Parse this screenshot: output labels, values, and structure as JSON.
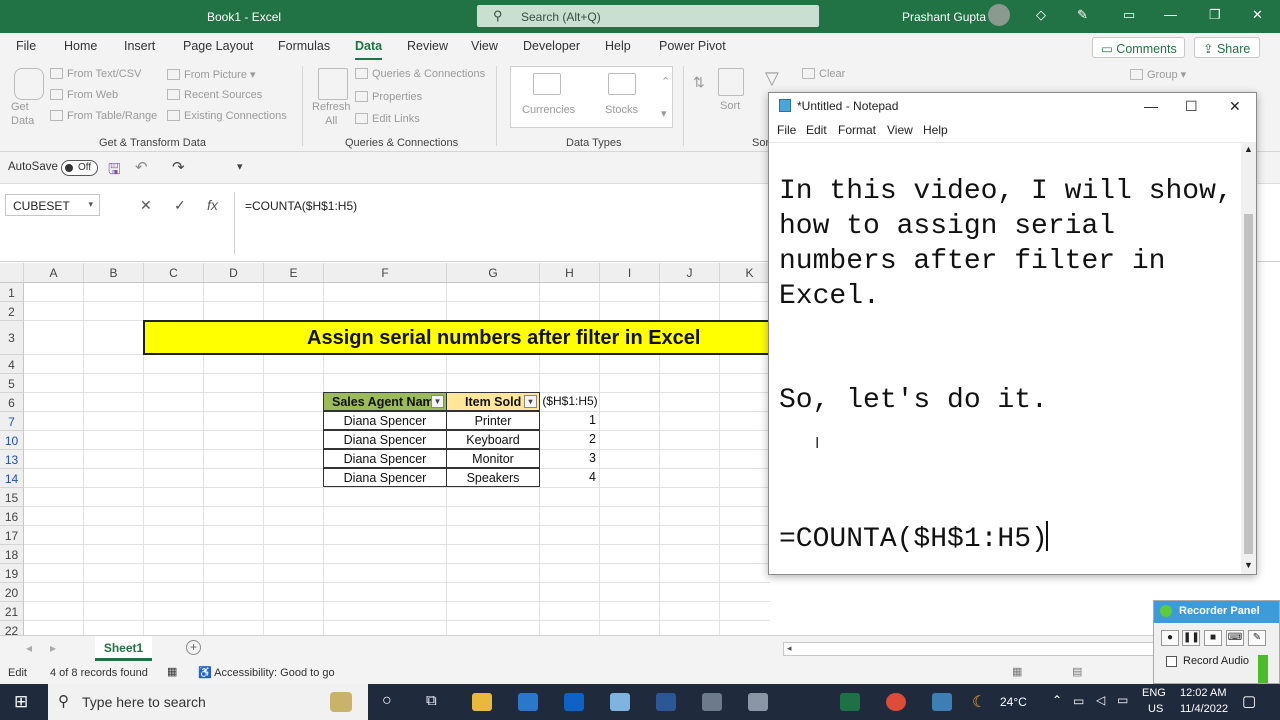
{
  "colors": {
    "excel_green": "#217346",
    "banner_yellow": "#ffff00",
    "header_green": "#9bbb59",
    "header_yellow": "#ffe699"
  },
  "titlebar": {
    "title": "Book1  -  Excel",
    "search_placeholder": "Search (Alt+Q)",
    "user": "Prashant Gupta"
  },
  "menu": {
    "items": [
      "File",
      "Home",
      "Insert",
      "Page Layout",
      "Formulas",
      "Data",
      "Review",
      "View",
      "Developer",
      "Help",
      "Power Pivot"
    ],
    "active": "Data",
    "comments": "Comments",
    "share": "Share"
  },
  "ribbon": {
    "get_data": "Get\nData",
    "from_text_csv": "From Text/CSV",
    "from_web": "From Web",
    "from_table_range": "From Table/Range",
    "from_picture": "From Picture",
    "recent_sources": "Recent Sources",
    "existing_connections": "Existing Connections",
    "group_get_transform": "Get & Transform Data",
    "refresh_all": "Refresh\nAll",
    "queries_connections": "Queries & Connections",
    "properties": "Properties",
    "edit_links": "Edit Links",
    "group_queries": "Queries & Connections",
    "currencies": "Currencies",
    "stocks": "Stocks",
    "group_data_types": "Data Types",
    "sort": "Sort",
    "clear": "Clear",
    "group_sort_partial": "Sor",
    "group": "Group"
  },
  "qat": {
    "autosave": "AutoSave",
    "toggle_state": "Off"
  },
  "formula_bar": {
    "name_box": "CUBESET",
    "formula": "=COUNTA($H$1:H5)"
  },
  "grid": {
    "columns": [
      "A",
      "B",
      "C",
      "D",
      "E",
      "F",
      "G",
      "H",
      "I",
      "J",
      "K"
    ],
    "rows": [
      "1",
      "2",
      "3",
      "4",
      "5",
      "6",
      "7",
      "10",
      "13",
      "14",
      "15",
      "16",
      "17",
      "18",
      "19",
      "20",
      "21",
      "22"
    ],
    "banner": "Assign serial numbers after filter in Excel",
    "header_f": "Sales Agent Nam",
    "header_g": "Item Sold",
    "h6_text": "($H$1:H5)",
    "data": [
      {
        "agent": "Diana Spencer",
        "item": "Printer",
        "serial": "1"
      },
      {
        "agent": "Diana Spencer",
        "item": "Keyboard",
        "serial": "2"
      },
      {
        "agent": "Diana Spencer",
        "item": "Monitor",
        "serial": "3"
      },
      {
        "agent": "Diana Spencer",
        "item": "Speakers",
        "serial": "4"
      }
    ]
  },
  "sheet_tabs": {
    "active": "Sheet1"
  },
  "status": {
    "mode": "Edit",
    "records": "4 of 8 records found",
    "accessibility": "Accessibility: Good to go"
  },
  "taskbar": {
    "search": "Type here to search",
    "weather": "24°C",
    "lang1": "ENG",
    "lang2": "US",
    "time": "12:02 AM",
    "date": "11/4/2022"
  },
  "notepad": {
    "title": "*Untitled - Notepad",
    "menu": [
      "File",
      "Edit",
      "Format",
      "View",
      "Help"
    ],
    "lines": [
      "In this video, I will show,",
      "how to assign serial",
      "numbers after filter in",
      "Excel.",
      "So, let's do it.",
      "=COUNTA($H$1:H5)"
    ]
  },
  "recorder": {
    "title": "Recorder Panel",
    "record_audio": "Record Audio"
  }
}
